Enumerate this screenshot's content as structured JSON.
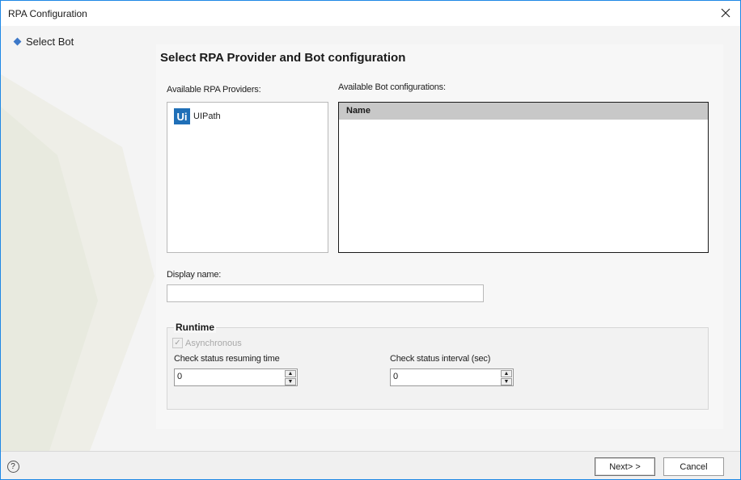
{
  "window": {
    "title": "RPA Configuration"
  },
  "nav": {
    "items": [
      {
        "label": "Select Bot"
      }
    ]
  },
  "main": {
    "heading": "Select RPA Provider and Bot configuration",
    "providers_label": "Available RPA Providers:",
    "providers": [
      {
        "name": "UIPath",
        "logo_text": "Ui"
      }
    ],
    "bots_label": "Available Bot configurations:",
    "bots_columns": [
      "Name"
    ],
    "display_name_label": "Display name:",
    "display_name_value": ""
  },
  "runtime": {
    "legend": "Runtime",
    "async_label": "Asynchronous",
    "async_checked": true,
    "resume_label": "Check status resuming time",
    "resume_value": "0",
    "interval_label": "Check status interval (sec)",
    "interval_value": "0"
  },
  "footer": {
    "next_label": "Next> >",
    "cancel_label": "Cancel",
    "help_glyph": "?"
  },
  "colors": {
    "accent": "#1e88e5",
    "logo": "#1f6fb7",
    "nav_bullet": "#3c78c8"
  }
}
